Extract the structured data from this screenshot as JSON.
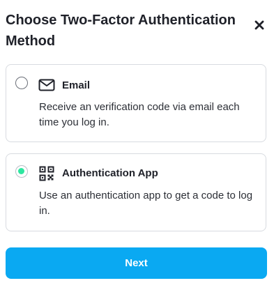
{
  "dialog": {
    "title": "Choose Two-Factor Authentication Method",
    "close_icon": "close-icon"
  },
  "options": [
    {
      "label": "Email",
      "description": "Receive an verification code via email each time you log in.",
      "icon": "envelope-icon",
      "selected": false
    },
    {
      "label": "Authentication App",
      "description": "Use an authentication app to get a code to log in.",
      "icon": "qr-code-icon",
      "selected": true
    }
  ],
  "actions": {
    "next_label": "Next"
  },
  "colors": {
    "accent": "#0aa9f2",
    "radio_selected": "#2ee6a0",
    "border": "#d8dbe0",
    "text": "#1f2129"
  }
}
